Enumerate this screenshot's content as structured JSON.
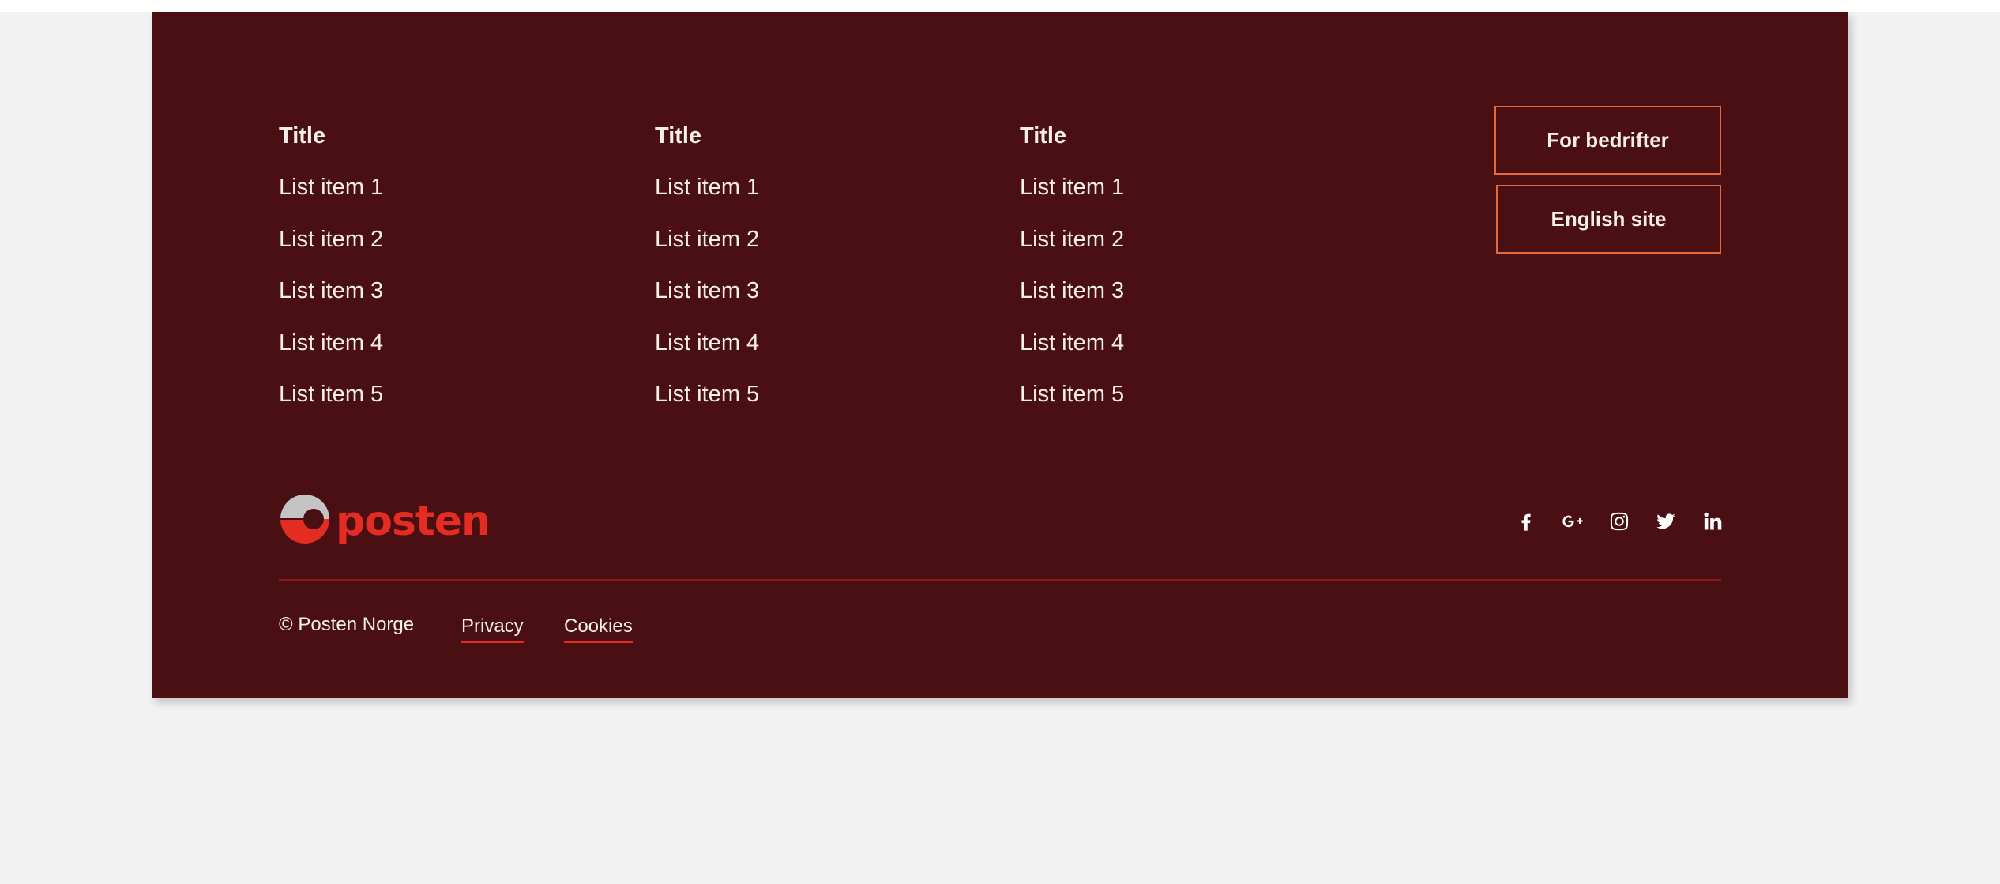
{
  "columns": [
    {
      "title": "Title",
      "items": [
        "List item 1",
        "List item 2",
        "List item 3",
        "List item 4",
        "List item 5"
      ]
    },
    {
      "title": "Title",
      "items": [
        "List item 1",
        "List item 2",
        "List item 3",
        "List item 4",
        "List item 5"
      ]
    },
    {
      "title": "Title",
      "items": [
        "List item 1",
        "List item 2",
        "List item 3",
        "List item 4",
        "List item 5"
      ]
    }
  ],
  "buttons": {
    "business": "For bedrifter",
    "english": "English site"
  },
  "logo": {
    "wordmark": "posten"
  },
  "social": [
    "facebook-icon",
    "google-plus-icon",
    "instagram-icon",
    "twitter-icon",
    "linkedin-icon"
  ],
  "bottom": {
    "copyright": "© Posten Norge",
    "privacy": "Privacy",
    "cookies": "Cookies"
  },
  "colors": {
    "footer_bg": "#4a0f13",
    "accent_red": "#e32d22",
    "button_border": "#e36a3b",
    "page_bg": "#f2f2f2"
  }
}
